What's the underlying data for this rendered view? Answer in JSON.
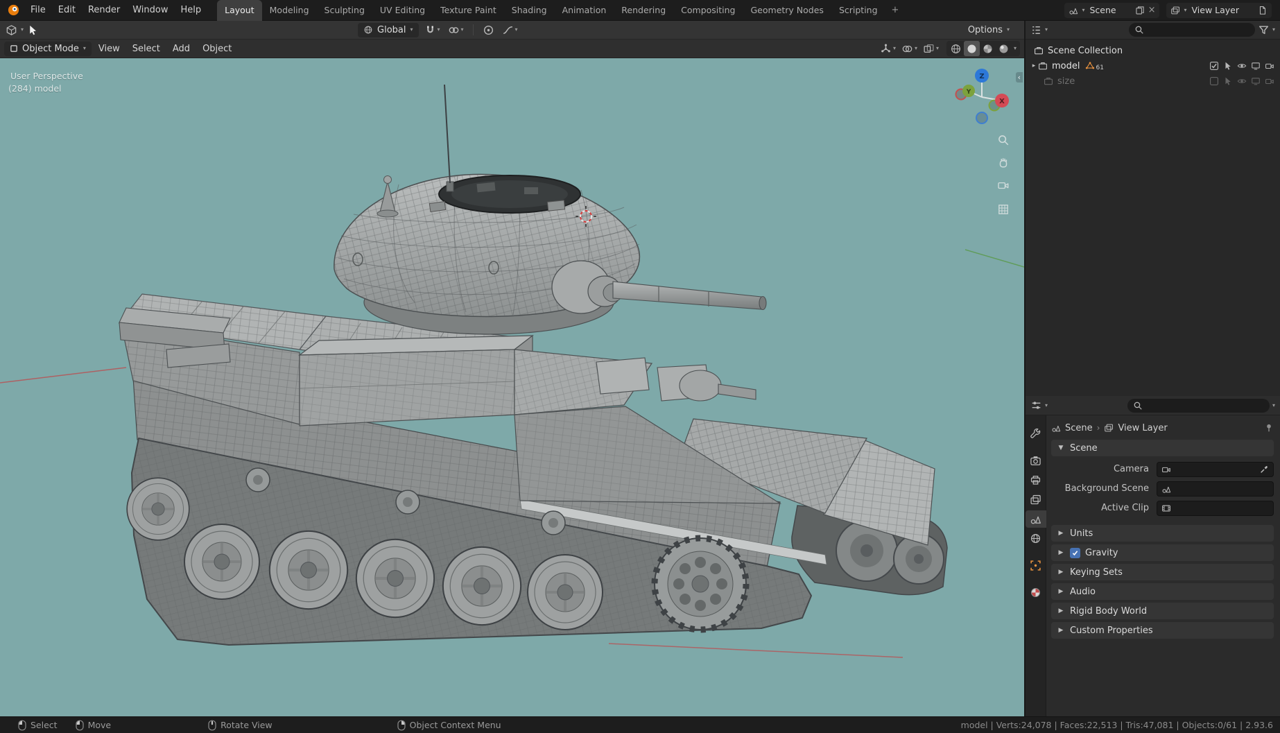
{
  "topbar": {
    "menus": [
      "File",
      "Edit",
      "Render",
      "Window",
      "Help"
    ],
    "workspaces": [
      "Layout",
      "Modeling",
      "Sculpting",
      "UV Editing",
      "Texture Paint",
      "Shading",
      "Animation",
      "Rendering",
      "Compositing",
      "Geometry Nodes",
      "Scripting"
    ],
    "add_workspace": "+",
    "scene": {
      "label": "Scene"
    },
    "view_layer": {
      "label": "View Layer"
    }
  },
  "toolsettings": {
    "orientation": "Global",
    "options": "Options"
  },
  "viewport": {
    "mode": "Object Mode",
    "menus": [
      "View",
      "Select",
      "Add",
      "Object"
    ],
    "overlay_line1": "User Perspective",
    "overlay_line2": "(284) model",
    "gizmo": {
      "x": "X",
      "y": "Y",
      "z": "Z"
    }
  },
  "outliner": {
    "root": "Scene Collection",
    "items": [
      {
        "label": "model",
        "badge": "61"
      },
      {
        "label": "size",
        "badge": ""
      }
    ]
  },
  "properties": {
    "path_scene": "Scene",
    "path_layer": "View Layer",
    "fields": [
      {
        "label": "Camera"
      },
      {
        "label": "Background Scene"
      },
      {
        "label": "Active Clip"
      }
    ],
    "panels": [
      {
        "label": "Scene"
      },
      {
        "label": "Units"
      },
      {
        "label": "Gravity"
      },
      {
        "label": "Keying Sets"
      },
      {
        "label": "Audio"
      },
      {
        "label": "Rigid Body World"
      },
      {
        "label": "Custom Properties"
      }
    ]
  },
  "statusbar": {
    "hints": [
      "Select",
      "Move",
      "Rotate View",
      "Object Context Menu"
    ],
    "stats": "model | Verts:24,078 | Faces:22,513 | Tris:47,081 | Objects:0/61 | 2.93.6"
  },
  "colors": {
    "viewport_bg": "#7ea9a9",
    "accent_blue": "#4772b3",
    "object_orange": "#e8923f"
  }
}
